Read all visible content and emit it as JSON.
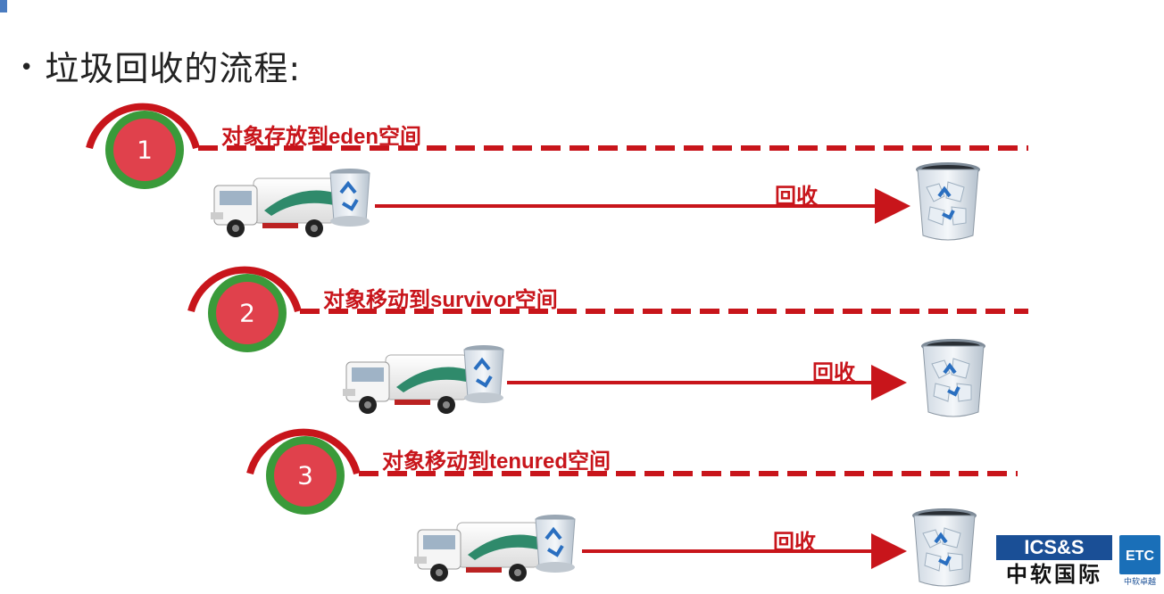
{
  "title": "垃圾回收的流程:",
  "steps": [
    {
      "number": "1",
      "label": "对象存放到eden空间",
      "action": "回收"
    },
    {
      "number": "2",
      "label": "对象移动到survivor空间",
      "action": "回收"
    },
    {
      "number": "3",
      "label": "对象移动到tenured空间",
      "action": "回收"
    }
  ],
  "logo": {
    "main": "ICS&S",
    "sub": "中软国际",
    "badge": "ETC",
    "badge_sub": "中软卓越"
  },
  "colors": {
    "accent_red": "#c8151b",
    "ring_green": "#3a9a3a",
    "circle_red": "#e0414c"
  }
}
